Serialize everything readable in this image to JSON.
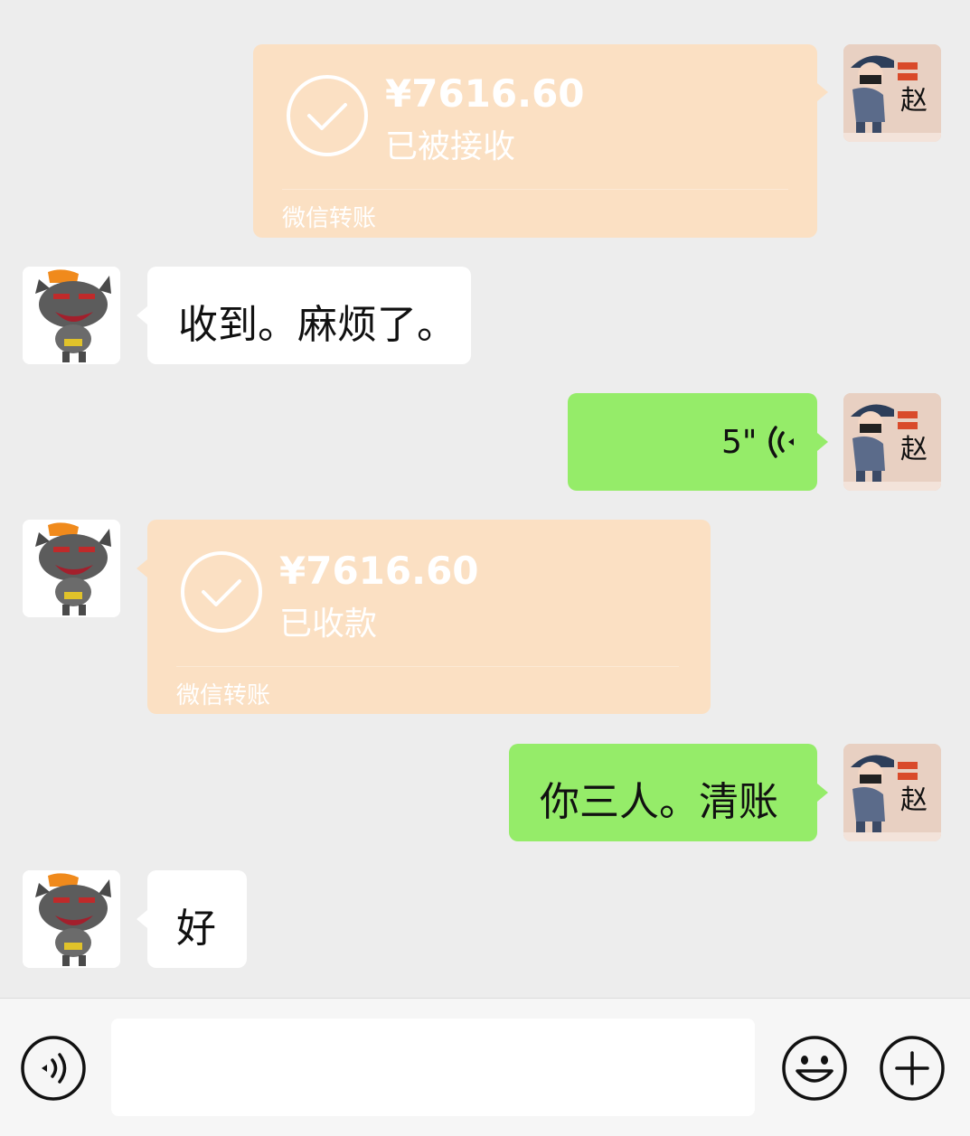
{
  "messages": {
    "m1": {
      "amount": "¥7616.60",
      "status": "已被接收",
      "footer": "微信转账"
    },
    "m2": {
      "text": "收到。麻烦了。"
    },
    "m3": {
      "duration": "5\""
    },
    "m4": {
      "amount": "¥7616.60",
      "status": "已收款",
      "footer": "微信转账"
    },
    "m5": {
      "text": "你三人。清账"
    },
    "m6": {
      "text": "好"
    }
  },
  "avatars": {
    "me_char": "赵"
  },
  "colors": {
    "bg": "#ededed",
    "green": "#95ec69",
    "transfer": "#fbe0c3"
  },
  "icons": {
    "voice": "voice-icon",
    "emoji": "emoji-icon",
    "plus": "plus-icon"
  }
}
